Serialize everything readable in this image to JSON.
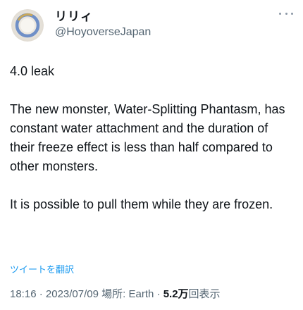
{
  "author": {
    "display_name": "リリィ",
    "handle": "@HoyoverseJapan",
    "avatar_icon": "avatar-ring-icon"
  },
  "more_icon": "more-horizontal-icon",
  "tweet": {
    "paragraph1": "4.0 leak",
    "paragraph2": "The new monster, Water-Splitting Phantasm, has constant water attachment and the duration of their freeze effect is less than half compared to other monsters.",
    "paragraph3": "It is possible to pull them while they are frozen."
  },
  "translate_label": "ツイートを翻訳",
  "meta": {
    "time": "18:16",
    "sep1": " · ",
    "date": "2023/07/09",
    "location_label": " 場所: ",
    "location": "Earth",
    "sep2": " · ",
    "views_count": "5.2万",
    "views_label": "回表示"
  },
  "colors": {
    "text": "#0f1419",
    "secondary": "#536471",
    "link": "#1d9bf0"
  }
}
